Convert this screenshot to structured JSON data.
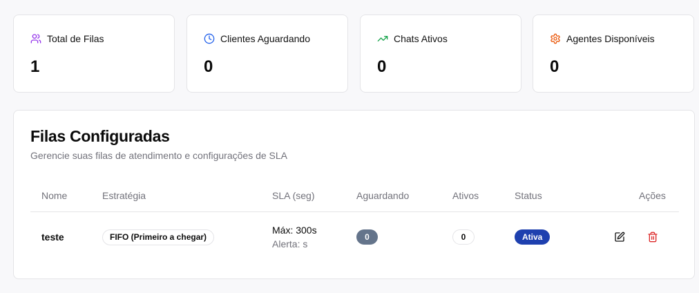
{
  "colors": {
    "queues_icon": "#9333ea",
    "waiting_icon": "#2563eb",
    "chats_icon": "#16a34a",
    "agents_icon": "#ea580c",
    "status_active": "#1e40af",
    "waiting_badge": "#64748b",
    "delete_icon": "#dc2626"
  },
  "stats": [
    {
      "icon": "users-icon",
      "label": "Total de Filas",
      "value": "1"
    },
    {
      "icon": "clock-icon",
      "label": "Clientes Aguardando",
      "value": "0"
    },
    {
      "icon": "trending-up-icon",
      "label": "Chats Ativos",
      "value": "0"
    },
    {
      "icon": "gear-icon",
      "label": "Agentes Disponíveis",
      "value": "0"
    }
  ],
  "queues": {
    "title": "Filas Configuradas",
    "subtitle": "Gerencie suas filas de atendimento e configurações de SLA",
    "columns": [
      "Nome",
      "Estratégia",
      "SLA (seg)",
      "Aguardando",
      "Ativos",
      "Status",
      "Ações"
    ],
    "rows": [
      {
        "name": "teste",
        "strategy": "FIFO (Primeiro a chegar)",
        "sla_max": "Máx: 300s",
        "sla_alert": "Alerta: s",
        "waiting": "0",
        "active": "0",
        "status": "Ativa",
        "actions": [
          "edit-icon",
          "trash-icon"
        ]
      }
    ]
  }
}
